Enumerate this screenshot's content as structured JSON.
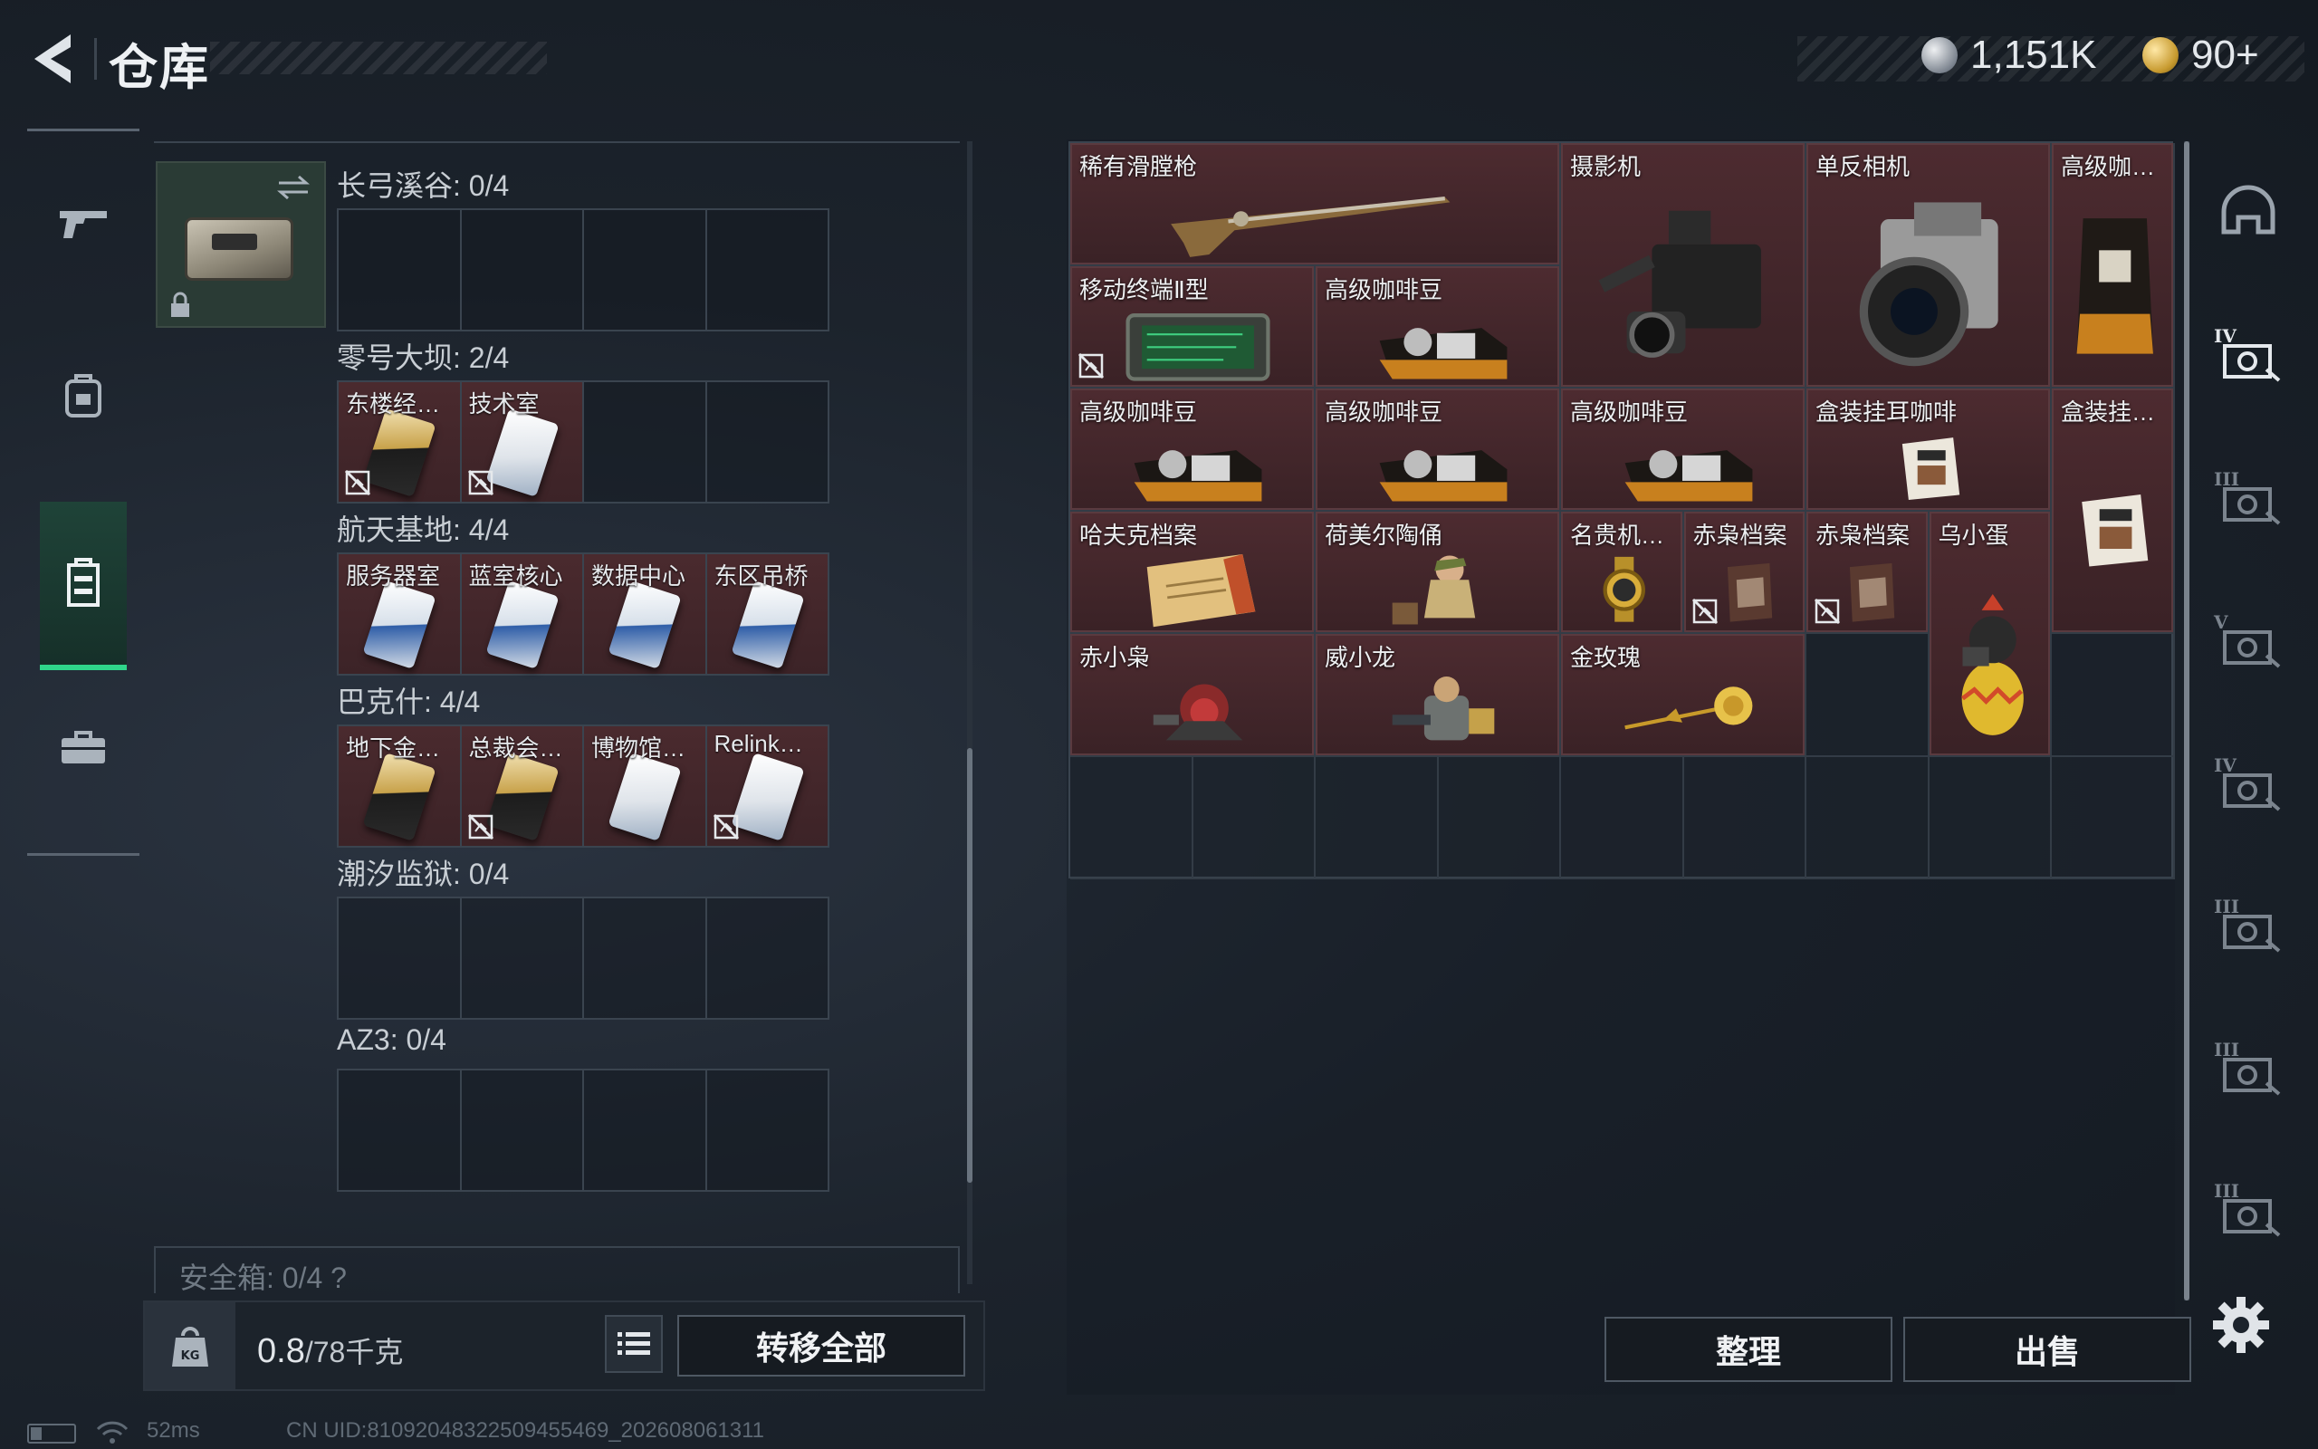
{
  "header": {
    "title": "仓库"
  },
  "currency": {
    "silver": "1,151K",
    "gold": "90+"
  },
  "nav": {
    "items": [
      "weapon-icon",
      "backpack-icon",
      "storage-icon",
      "briefcase-icon"
    ],
    "active_index": 2
  },
  "stash": {
    "groups": [
      {
        "title": "长弓溪谷: 0/4",
        "slots": []
      },
      {
        "title": "零号大坝: 2/4",
        "slots": [
          {
            "label": "东楼经…",
            "card": "gold",
            "nontrade": true
          },
          {
            "label": "技术室",
            "card": "white",
            "nontrade": true
          }
        ]
      },
      {
        "title": "航天基地: 4/4",
        "slots": [
          {
            "label": "服务器室",
            "card": "blue",
            "nontrade": false
          },
          {
            "label": "蓝室核心",
            "card": "blue",
            "nontrade": false
          },
          {
            "label": "数据中心",
            "card": "blue",
            "nontrade": false
          },
          {
            "label": "东区吊桥",
            "card": "blue",
            "nontrade": false
          }
        ]
      },
      {
        "title": "巴克什: 4/4",
        "slots": [
          {
            "label": "地下金…",
            "card": "gold",
            "nontrade": false
          },
          {
            "label": "总裁会…",
            "card": "gold",
            "nontrade": true
          },
          {
            "label": "博物馆…",
            "card": "white",
            "nontrade": false
          },
          {
            "label": "Relink…",
            "card": "white",
            "nontrade": true
          }
        ]
      },
      {
        "title": "潮汐监狱: 0/4",
        "slots": []
      },
      {
        "title": "AZ3: 0/4",
        "slots": []
      }
    ],
    "safe_box": "安全箱: 0/4 ?"
  },
  "weight": {
    "current": "0.8",
    "max": "/78千克"
  },
  "buttons": {
    "transfer_all": "转移全部",
    "sort": "整理",
    "sell": "出售"
  },
  "status": {
    "ping": "52ms",
    "uid": "CN UID:81092048322509455469_202608061311"
  },
  "inventory": {
    "items": [
      {
        "label": "稀有滑膛枪",
        "art": "musket-icon",
        "nontrade": false
      },
      {
        "label": "摄影机",
        "art": "camcorder-icon",
        "nontrade": false
      },
      {
        "label": "单反相机",
        "art": "camera-icon",
        "nontrade": false
      },
      {
        "label": "高级咖…",
        "art": "coffee-bag-icon",
        "nontrade": false
      },
      {
        "label": "移动终端Ⅱ型",
        "art": "terminal-icon",
        "nontrade": true
      },
      {
        "label": "高级咖啡豆",
        "art": "coffee-tin-icon",
        "nontrade": false
      },
      {
        "label": "高级咖啡豆",
        "art": "coffee-tin-icon",
        "nontrade": false
      },
      {
        "label": "高级咖啡豆",
        "art": "coffee-tin-icon",
        "nontrade": false
      },
      {
        "label": "高级咖啡豆",
        "art": "coffee-tin-icon",
        "nontrade": false
      },
      {
        "label": "盒装挂耳咖啡",
        "art": "coffee-box-icon",
        "nontrade": false
      },
      {
        "label": "盒装挂…",
        "art": "coffee-box-icon",
        "nontrade": false
      },
      {
        "label": "哈夫克档案",
        "art": "file-icon",
        "nontrade": false
      },
      {
        "label": "荷美尔陶俑",
        "art": "figurine-icon",
        "nontrade": false
      },
      {
        "label": "名贵机…",
        "art": "watch-icon",
        "nontrade": false
      },
      {
        "label": "赤枭档案",
        "art": "folder-icon",
        "nontrade": true
      },
      {
        "label": "赤枭档案",
        "art": "folder-icon",
        "nontrade": true
      },
      {
        "label": "乌小蛋",
        "art": "egg-figure-icon",
        "nontrade": false
      },
      {
        "label": "赤小枭",
        "art": "owl-figure-icon",
        "nontrade": false
      },
      {
        "label": "威小龙",
        "art": "soldier-figure-icon",
        "nontrade": false
      },
      {
        "label": "金玫瑰",
        "art": "rose-icon",
        "nontrade": false
      }
    ]
  },
  "rail": {
    "icons": [
      "helmet-icon",
      "armor-iv-icon",
      "armor-iii-icon",
      "armor-v-icon",
      "rig-iv-icon",
      "rig-iii-icon",
      "armor-iii-b-icon",
      "rig-iii-b-icon"
    ]
  },
  "colors": {
    "accent": "#2fd68a",
    "item_bg": "#4d2b30"
  }
}
